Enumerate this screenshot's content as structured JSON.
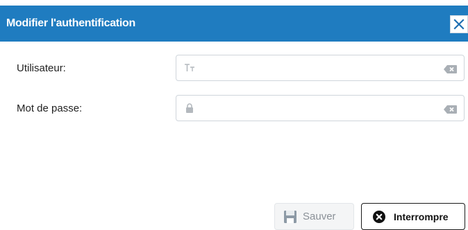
{
  "dialog": {
    "title": "Modifier l'authentification",
    "close_icon": "close-icon"
  },
  "fields": [
    {
      "label": "Utilisateur:",
      "value": "",
      "lead_icon": "text-type-icon",
      "clear_icon": "clear-input-icon"
    },
    {
      "label": "Mot de passe:",
      "value": "",
      "lead_icon": "lock-icon",
      "clear_icon": "clear-input-icon"
    }
  ],
  "buttons": {
    "save_label": "Sauver",
    "save_icon": "floppy-disk-icon",
    "save_disabled": true,
    "abort_label": "Interrompre",
    "abort_icon": "cancel-circle-icon"
  },
  "colors": {
    "titlebar": "#1f7cc0",
    "title_text": "#ffffff",
    "border": "#cfd5db",
    "disabled_text": "#8a9097"
  }
}
